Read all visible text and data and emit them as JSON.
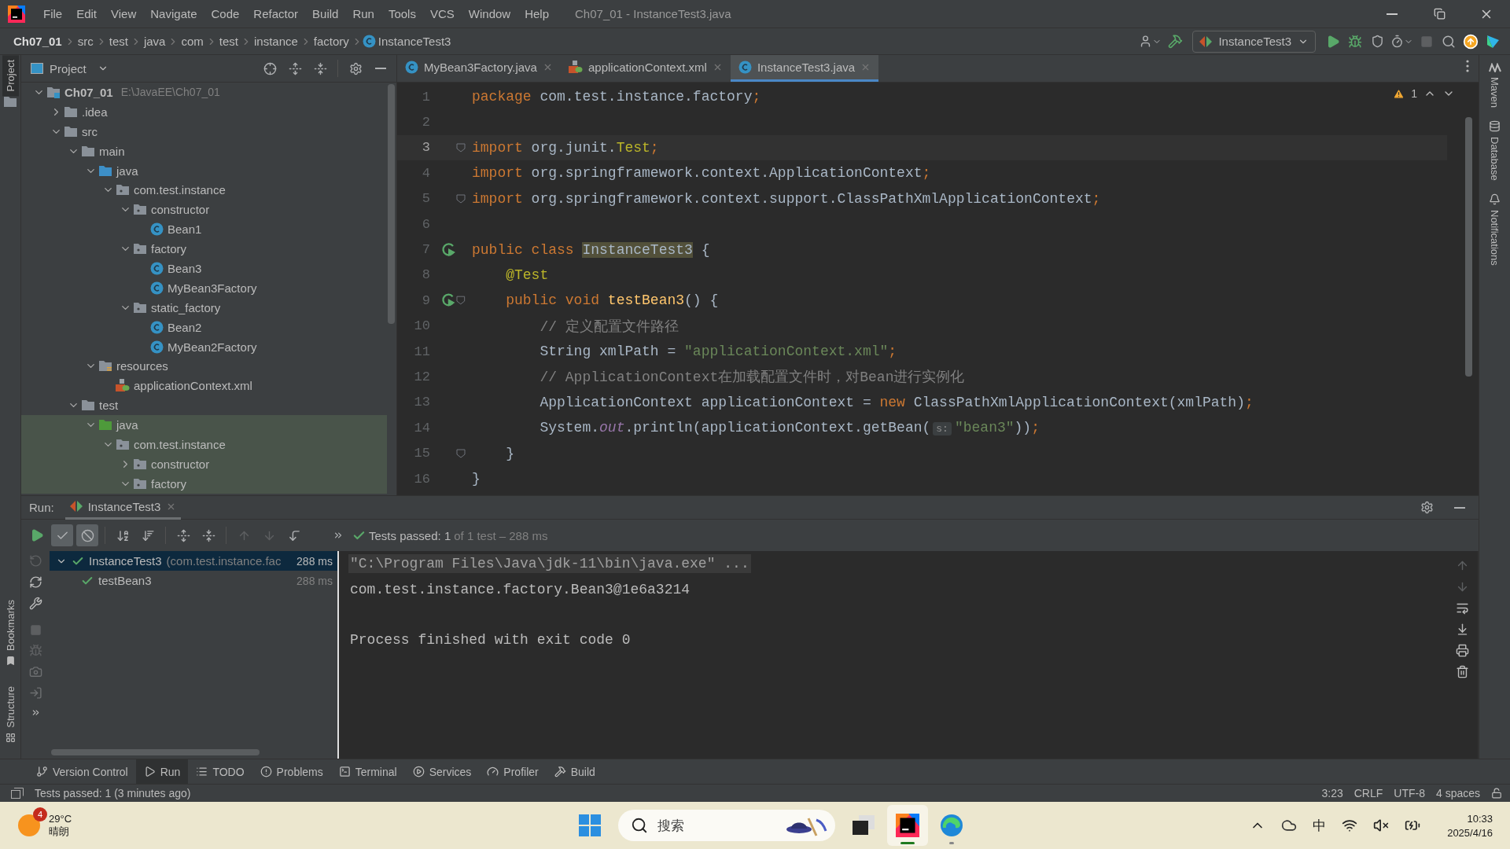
{
  "window": {
    "title": "Ch07_01 - InstanceTest3.java"
  },
  "menu": [
    "File",
    "Edit",
    "View",
    "Navigate",
    "Code",
    "Refactor",
    "Build",
    "Run",
    "Tools",
    "VCS",
    "Window",
    "Help"
  ],
  "breadcrumbs": [
    {
      "label": "Ch07_01",
      "kind": "project"
    },
    {
      "label": "src",
      "kind": "dir"
    },
    {
      "label": "test",
      "kind": "dir"
    },
    {
      "label": "java",
      "kind": "dir"
    },
    {
      "label": "com",
      "kind": "dir"
    },
    {
      "label": "test",
      "kind": "dir"
    },
    {
      "label": "instance",
      "kind": "dir"
    },
    {
      "label": "factory",
      "kind": "dir"
    },
    {
      "label": "InstanceTest3",
      "kind": "class"
    }
  ],
  "run_config": {
    "label": "InstanceTest3"
  },
  "left_tool_tabs_top": [
    {
      "label": "Project",
      "selected": true
    }
  ],
  "left_tool_tabs_bottom": [
    {
      "label": "Bookmarks",
      "kind": "bookmarks",
      "selected": false
    },
    {
      "label": "Structure",
      "kind": "structure",
      "selected": false
    }
  ],
  "right_tool_tabs": [
    {
      "label": "Maven",
      "kind": "maven"
    },
    {
      "label": "Database",
      "kind": "database"
    },
    {
      "label": "Notifications",
      "kind": "notifications"
    }
  ],
  "project_panel": {
    "title": "Project",
    "tree": [
      {
        "label": "Ch07_01",
        "kind": "module",
        "note": "E:\\JavaEE\\Ch07_01",
        "expanded": true,
        "children": [
          {
            "label": ".idea",
            "kind": "folder",
            "expanded": false
          },
          {
            "label": "src",
            "kind": "folder",
            "expanded": true,
            "children": [
              {
                "label": "main",
                "kind": "folder",
                "expanded": true,
                "children": [
                  {
                    "label": "java",
                    "kind": "source",
                    "expanded": true,
                    "children": [
                      {
                        "label": "com.test.instance",
                        "kind": "package",
                        "expanded": true,
                        "children": [
                          {
                            "label": "constructor",
                            "kind": "package",
                            "expanded": true,
                            "children": [
                              {
                                "label": "Bean1",
                                "kind": "class"
                              }
                            ]
                          },
                          {
                            "label": "factory",
                            "kind": "package",
                            "expanded": true,
                            "children": [
                              {
                                "label": "Bean3",
                                "kind": "class"
                              },
                              {
                                "label": "MyBean3Factory",
                                "kind": "class"
                              }
                            ]
                          },
                          {
                            "label": "static_factory",
                            "kind": "package",
                            "expanded": true,
                            "children": [
                              {
                                "label": "Bean2",
                                "kind": "class"
                              },
                              {
                                "label": "MyBean2Factory",
                                "kind": "class"
                              }
                            ]
                          }
                        ]
                      }
                    ]
                  },
                  {
                    "label": "resources",
                    "kind": "resources",
                    "expanded": true,
                    "children": [
                      {
                        "label": "applicationContext.xml",
                        "kind": "xml"
                      }
                    ]
                  }
                ]
              },
              {
                "label": "test",
                "kind": "folder",
                "expanded": true,
                "children": [
                  {
                    "label": "java",
                    "kind": "test_source",
                    "test_scope": true,
                    "expanded": true,
                    "children": [
                      {
                        "label": "com.test.instance",
                        "kind": "package",
                        "test_scope": true,
                        "expanded": true,
                        "children": [
                          {
                            "label": "constructor",
                            "kind": "package",
                            "test_scope": true,
                            "expanded": false
                          },
                          {
                            "label": "factory",
                            "kind": "package",
                            "test_scope": true,
                            "expanded": true
                          }
                        ]
                      }
                    ]
                  }
                ]
              }
            ]
          }
        ]
      }
    ]
  },
  "editor_tabs": [
    {
      "label": "MyBean3Factory.java",
      "kind": "class",
      "selected": false
    },
    {
      "label": "applicationContext.xml",
      "kind": "xml",
      "selected": false
    },
    {
      "label": "InstanceTest3.java",
      "kind": "class",
      "selected": true
    }
  ],
  "editor": {
    "warnings": "1",
    "lines": [
      {
        "number": "1",
        "tokens": [
          {
            "text": "package",
            "kind": "kw"
          },
          {
            "text": " com.test.instance.factory",
            "kind": "plain"
          },
          {
            "text": ";",
            "kind": "kw"
          }
        ]
      },
      {
        "number": "2"
      },
      {
        "number": "3",
        "current": true,
        "fold": true,
        "tokens": [
          {
            "text": "import",
            "kind": "kw"
          },
          {
            "text": " org.junit.",
            "kind": "plain"
          },
          {
            "text": "Test",
            "kind": "ann"
          },
          {
            "text": ";",
            "kind": "kw"
          }
        ]
      },
      {
        "number": "4",
        "tokens": [
          {
            "text": "import",
            "kind": "kw"
          },
          {
            "text": " org.springframework.context.ApplicationContext",
            "kind": "plain"
          },
          {
            "text": ";",
            "kind": "kw"
          }
        ]
      },
      {
        "number": "5",
        "fold": true,
        "tokens": [
          {
            "text": "import",
            "kind": "kw"
          },
          {
            "text": " org.springframework.context.support.ClassPathXmlApplicationContext",
            "kind": "plain"
          },
          {
            "text": ";",
            "kind": "kw"
          }
        ]
      },
      {
        "number": "6"
      },
      {
        "number": "7",
        "run": true,
        "tokens": [
          {
            "text": "public class ",
            "kind": "kw"
          },
          {
            "text": "InstanceTest3",
            "kind": "decl"
          },
          {
            "text": " {",
            "kind": "plain"
          }
        ]
      },
      {
        "number": "8",
        "tokens": [
          {
            "text": "    @Test",
            "kind": "ann"
          }
        ]
      },
      {
        "number": "9",
        "run": true,
        "fold": true,
        "tokens": [
          {
            "text": "    public void ",
            "kind": "kw"
          },
          {
            "text": "testBean3",
            "kind": "method"
          },
          {
            "text": "() {",
            "kind": "plain"
          }
        ]
      },
      {
        "number": "10",
        "tokens": [
          {
            "text": "        // 定义配置文件路径",
            "kind": "comment"
          }
        ]
      },
      {
        "number": "11",
        "tokens": [
          {
            "text": "        String xmlPath = ",
            "kind": "plain"
          },
          {
            "text": "\"applicationContext.xml\"",
            "kind": "str"
          },
          {
            "text": ";",
            "kind": "kw"
          }
        ]
      },
      {
        "number": "12",
        "tokens": [
          {
            "text": "        // ApplicationContext在加载配置文件时，对Bean进行实例化",
            "kind": "comment"
          }
        ]
      },
      {
        "number": "13",
        "tokens": [
          {
            "text": "        ApplicationContext applicationContext = ",
            "kind": "plain"
          },
          {
            "text": "new",
            "kind": "kw"
          },
          {
            "text": " ClassPathXmlApplicationContext(xmlPath)",
            "kind": "plain"
          },
          {
            "text": ";",
            "kind": "kw"
          }
        ]
      },
      {
        "number": "14",
        "tokens": [
          {
            "text": "        System.",
            "kind": "plain"
          },
          {
            "text": "out",
            "kind": "field"
          },
          {
            "text": ".println(applicationContext.getBean(",
            "kind": "plain"
          },
          {
            "text": "s:",
            "kind": "hint"
          },
          {
            "text": "\"bean3\"",
            "kind": "str"
          },
          {
            "text": "))",
            "kind": "plain"
          },
          {
            "text": ";",
            "kind": "kw"
          }
        ]
      },
      {
        "number": "15",
        "fold": true,
        "tokens": [
          {
            "text": "    }",
            "kind": "plain"
          }
        ]
      },
      {
        "number": "16",
        "tokens": [
          {
            "text": "}",
            "kind": "plain"
          }
        ]
      }
    ]
  },
  "run_panel": {
    "label": "Run:",
    "tab": "InstanceTest3",
    "filters": [
      {
        "kind": "passed",
        "on": true
      },
      {
        "kind": "ignored",
        "on": true
      }
    ],
    "summary": "Tests passed: 1",
    "summary_detail": "of 1 test – 288 ms",
    "tests": [
      {
        "name": "InstanceTest3",
        "detail": "(com.test.instance.fac",
        "time": "288 ms",
        "selected": true,
        "expanded": true,
        "children": [
          {
            "name": "testBean3",
            "time": "288 ms",
            "selected": false
          }
        ]
      }
    ],
    "console": [
      {
        "text": "\"C:\\Program Files\\Java\\jdk-11\\bin\\java.exe\" ...",
        "kind": "command"
      },
      {
        "text": "com.test.instance.factory.Bean3@1e6a3214",
        "kind": "output"
      },
      {
        "text": "Process finished with exit code 0",
        "kind": "exit"
      }
    ]
  },
  "tool_windows": [
    {
      "label": "Version Control",
      "kind": "vcs",
      "selected": false
    },
    {
      "label": "Run",
      "kind": "run",
      "selected": true
    },
    {
      "label": "TODO",
      "kind": "todo",
      "selected": false
    },
    {
      "label": "Problems",
      "kind": "problems",
      "selected": false
    },
    {
      "label": "Terminal",
      "kind": "terminal",
      "selected": false
    },
    {
      "label": "Services",
      "kind": "services",
      "selected": false
    },
    {
      "label": "Profiler",
      "kind": "profiler",
      "selected": false
    },
    {
      "label": "Build",
      "kind": "build",
      "selected": false
    }
  ],
  "status_bar": {
    "message": "Tests passed: 1 (3 minutes ago)",
    "items": [
      "3:23",
      "CRLF",
      "UTF-8",
      "4 spaces"
    ]
  },
  "taskbar": {
    "weather": {
      "badge": "4",
      "temperature": "29°C",
      "condition": "晴朗"
    },
    "search": {
      "placeholder": "搜索"
    },
    "apps": [
      {
        "kind": "start",
        "selected": false,
        "running": false
      },
      {
        "kind": "taskview",
        "selected": false,
        "running": false
      },
      {
        "kind": "ide",
        "selected": true,
        "running": true
      },
      {
        "kind": "browser",
        "selected": false,
        "running": true
      }
    ],
    "input_method": "中",
    "time": "10:33",
    "date": "2025/4/16"
  }
}
